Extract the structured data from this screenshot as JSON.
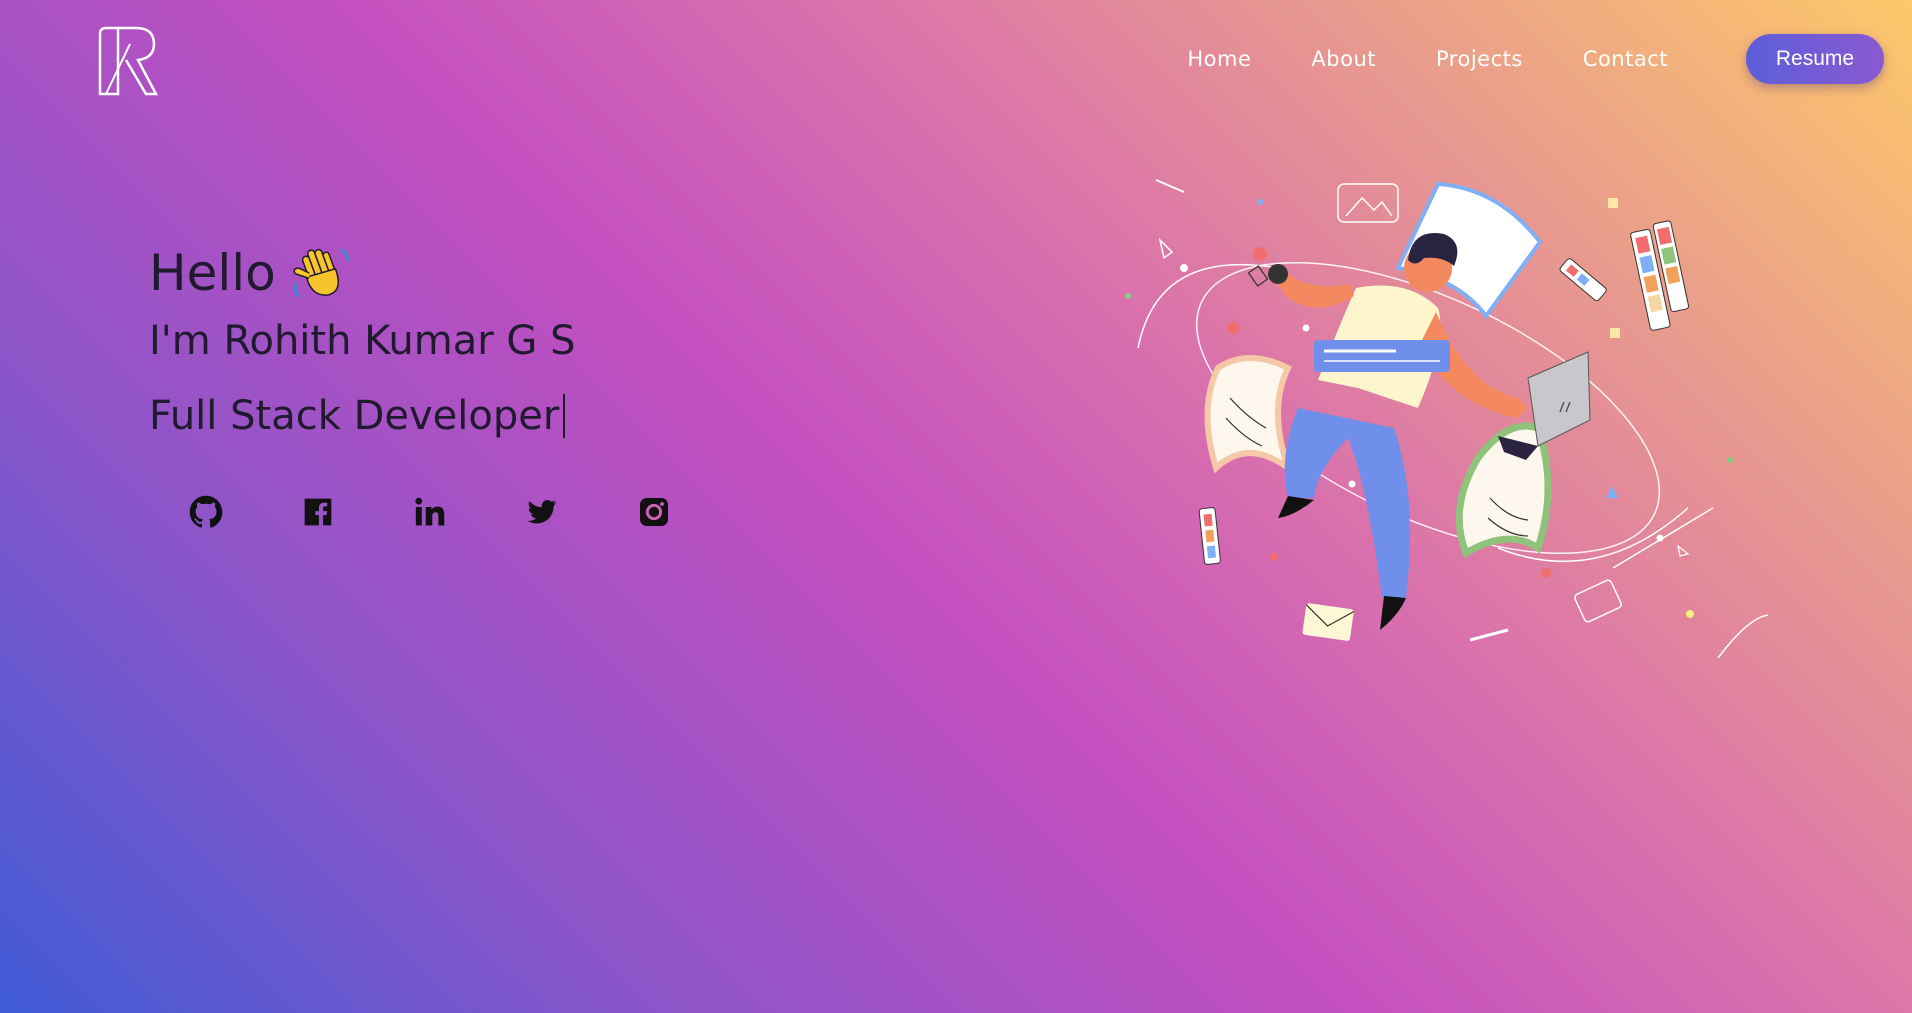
{
  "logo": {
    "icon": "rk-monogram-logo"
  },
  "nav": {
    "links": [
      "Home",
      "About",
      "Projects",
      "Contact"
    ],
    "resume_label": "Resume"
  },
  "hero": {
    "greeting": "Hello",
    "greeting_icon": "waving-hand-emoji",
    "name": "I'm Rohith Kumar G S",
    "role": "Full Stack Developer"
  },
  "socials": [
    {
      "icon": "github-icon"
    },
    {
      "icon": "facebook-icon"
    },
    {
      "icon": "linkedin-icon"
    },
    {
      "icon": "twitter-icon"
    },
    {
      "icon": "instagram-icon"
    }
  ],
  "colors": {
    "gradient_start": "#3f5bd6",
    "gradient_mid": "#c34fc0",
    "gradient_end": "#fdc86a",
    "resume_button": "#5c5fd9",
    "text_dark": "#1f1a2e"
  }
}
